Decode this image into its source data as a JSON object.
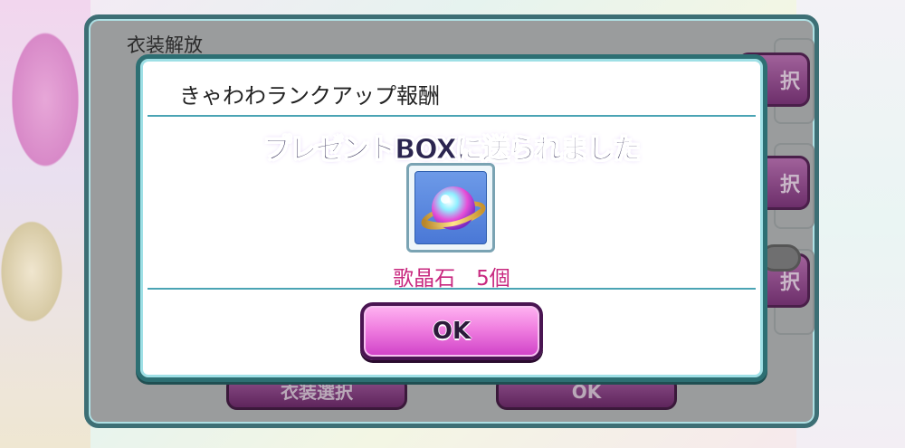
{
  "background": {
    "panel_title": "衣装解放",
    "row_buttons": [
      "択",
      "択",
      "択"
    ],
    "bottom_buttons": [
      "衣装選択",
      "OK"
    ]
  },
  "modal": {
    "title": "きゃわわランクアップ報酬",
    "message": "プレゼントBOXに送られました",
    "item": {
      "name": "歌晶石　5個",
      "icon": "crystal-planet-icon"
    },
    "ok_label": "OK"
  },
  "colors": {
    "modal_border": "#2d6f73",
    "separator": "#4aa4b4",
    "item_text": "#c8287f",
    "button_pink": "#f07fe0",
    "button_border": "#4a1552"
  }
}
